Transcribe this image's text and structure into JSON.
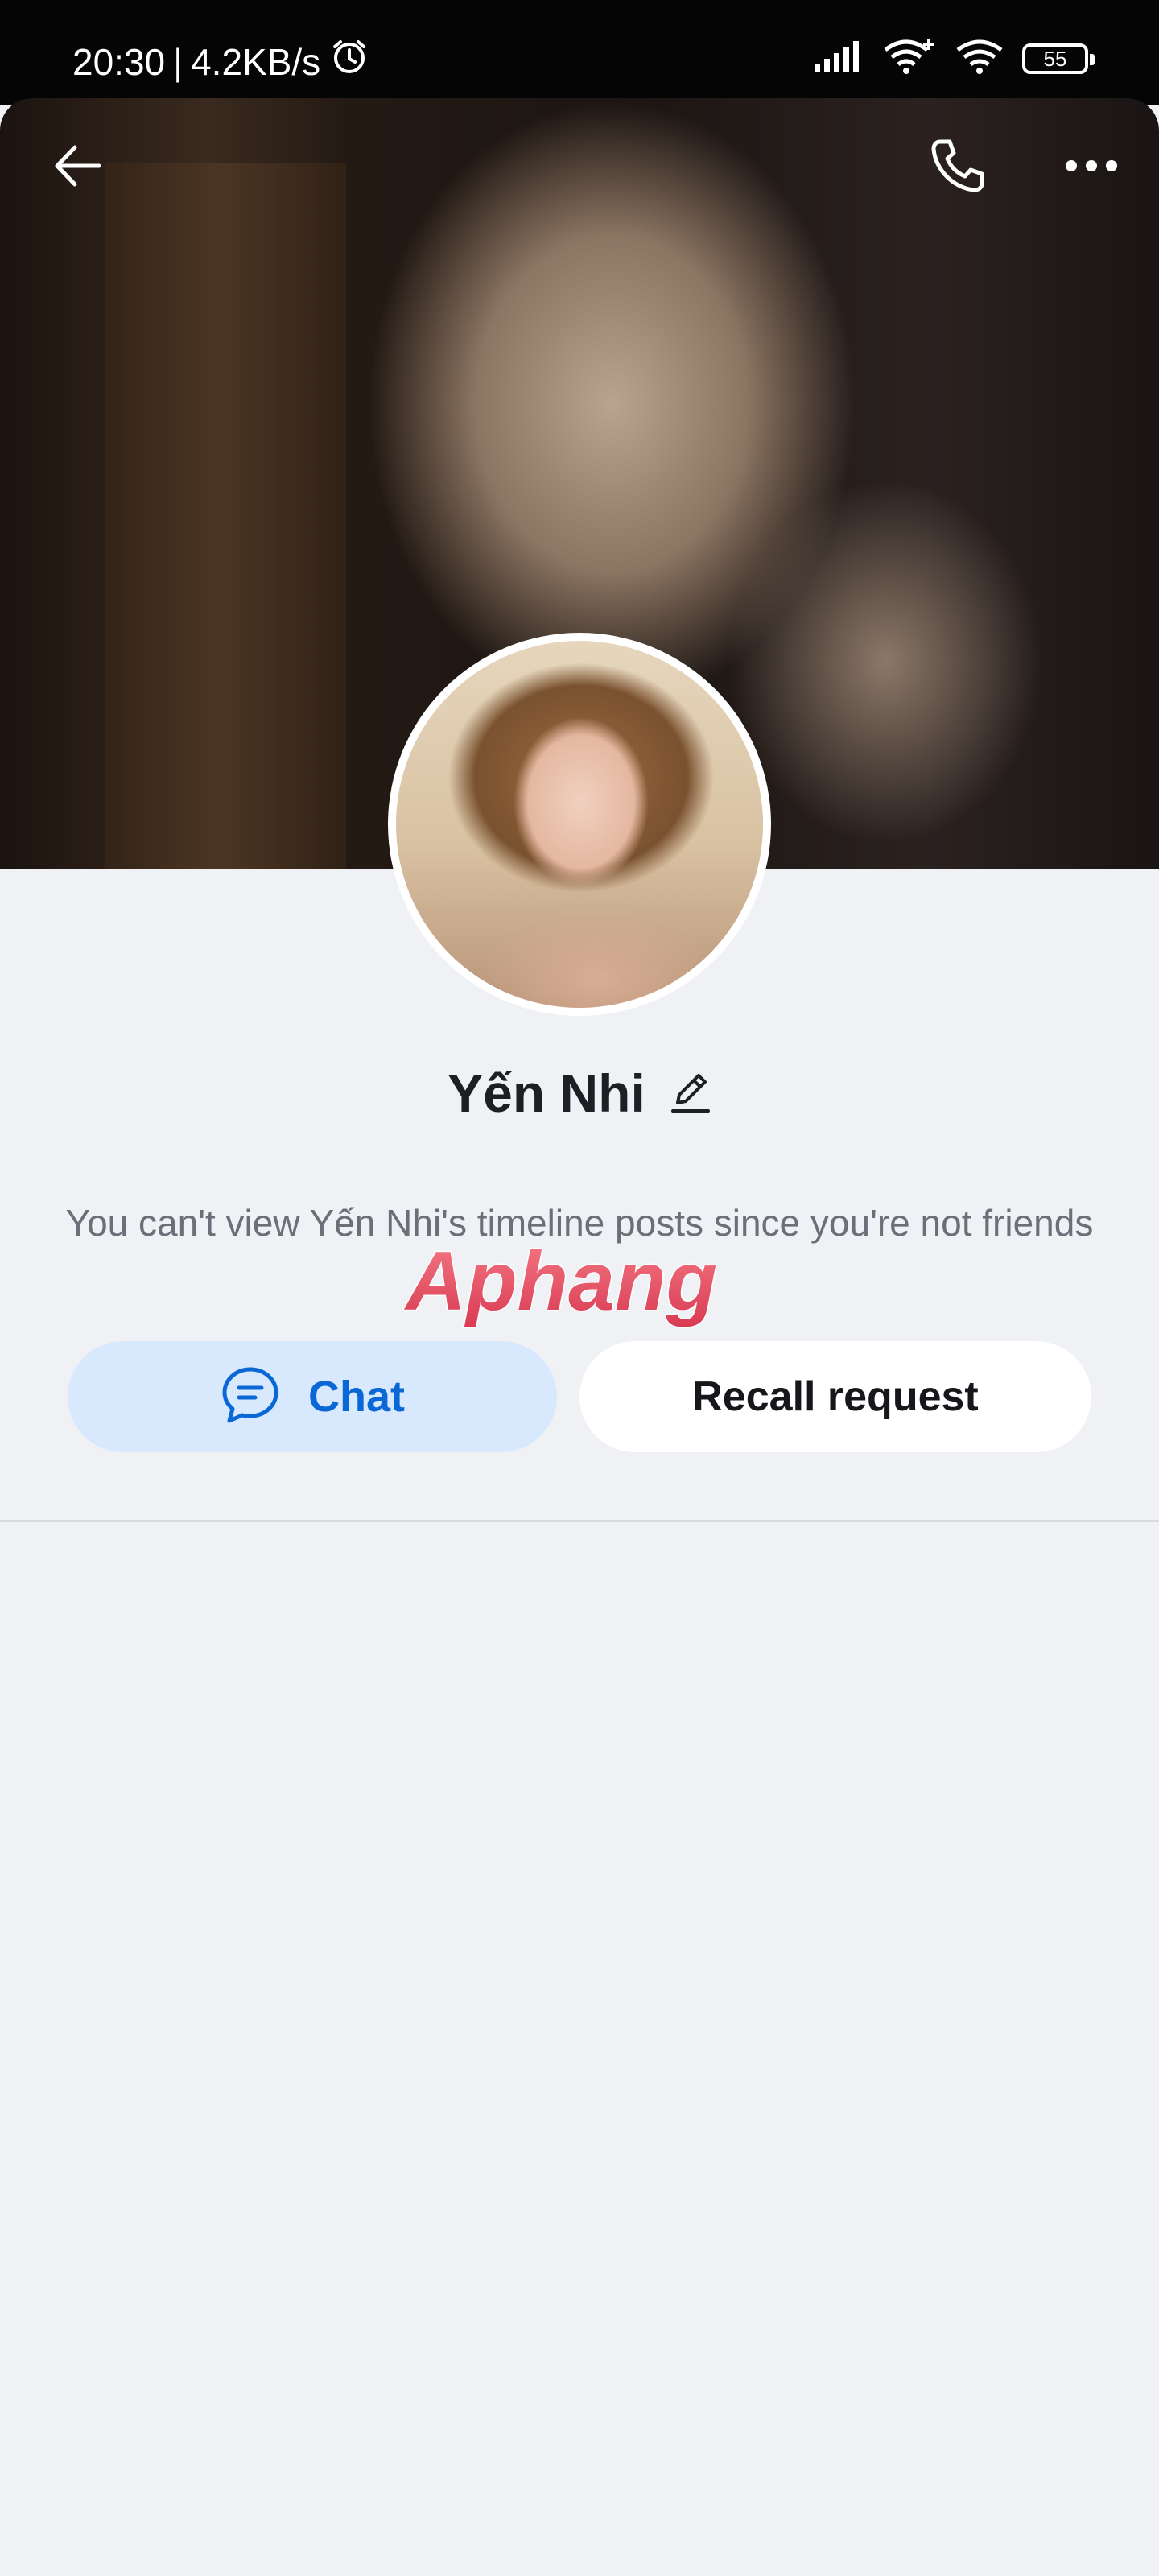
{
  "status_bar": {
    "time": "20:30",
    "separator": "|",
    "network_speed": "4.2KB/s",
    "battery_level": "55",
    "icons": [
      "alarm-icon",
      "signal-icon",
      "wifi-plus-icon",
      "wifi-icon",
      "battery-icon"
    ]
  },
  "header": {
    "icons": [
      "back-arrow-icon",
      "phone-icon",
      "more-dots-icon"
    ]
  },
  "profile": {
    "name": "Yến Nhi",
    "info_text": "You can't view Yến Nhi's timeline posts since you're not friends"
  },
  "actions": {
    "chat_label": "Chat",
    "recall_label": "Recall request"
  },
  "watermark": {
    "text": "Aphang"
  },
  "colors": {
    "accent": "#0a68d6",
    "chat_bg": "#d8e9fd",
    "page_bg": "#eff1f5"
  }
}
